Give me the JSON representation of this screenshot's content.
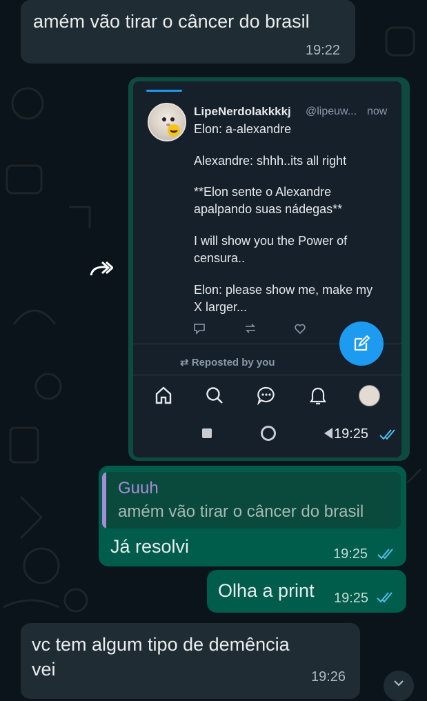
{
  "messages": {
    "m1": {
      "text": "amém vão tirar o câncer do brasil",
      "time": "19:22"
    },
    "screenshot": {
      "time": "19:25",
      "tweet": {
        "name": "LipeNerdolakkkkj",
        "handle": "@lipeuw...",
        "time": "now",
        "lines": [
          "Elon: a-alexandre",
          "Alexandre: shhh..its all right",
          "**Elon sente o Alexandre",
          "apalpando suas nádegas**",
          "I will show you the Power of",
          "censura..",
          "Elon: please show me, make my",
          "X larger..."
        ]
      },
      "repost_label": "Reposted by you"
    },
    "reply": {
      "quote_name": "Guuh",
      "quote_text": "amém vão tirar o câncer do brasil",
      "text": "Já resolvi",
      "time": "19:25"
    },
    "m3": {
      "text": "Olha a print",
      "time": "19:25"
    },
    "m4": {
      "line1": "vc tem algum tipo de demência",
      "line2": "vei",
      "time": "19:26"
    }
  },
  "colors": {
    "background": "#0b141a",
    "incoming": "#202c33",
    "outgoing": "#005c4b",
    "read_ticks": "#53bdeb",
    "quote_accent": "#a78bdb",
    "twitter_blue": "#1d9bf0"
  }
}
